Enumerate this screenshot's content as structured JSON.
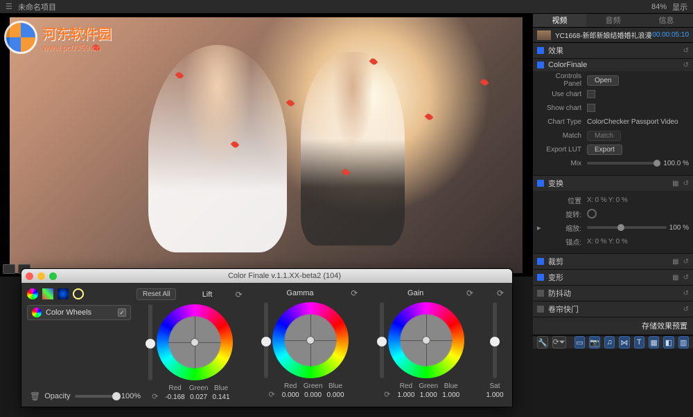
{
  "topbar": {
    "project": "未命名项目",
    "zoom": "84%",
    "display_btn": "显示"
  },
  "watermark": {
    "line1": "河东软件园",
    "line2": "www.pc0359.cn"
  },
  "inspector": {
    "tabs": {
      "video": "视频",
      "audio": "音频",
      "info": "信息"
    },
    "clip": {
      "name": "YC1668-新郎新娘结婚婚礼浪漫",
      "timecode": "00:00:05:10"
    },
    "effects": {
      "title": "效果"
    },
    "colorfinale": {
      "title": "ColorFinale",
      "controls_panel": "Controls Panel",
      "open": "Open",
      "use_chart": "Use chart",
      "show_chart": "Show chart",
      "chart_type": "Chart Type",
      "chart_type_val": "ColorChecker Passport Video",
      "match": "Match",
      "match_btn": "Match",
      "export_lut": "Export LUT",
      "export_btn": "Export",
      "mix": "Mix",
      "mix_val": "100.0 %"
    },
    "transform": {
      "title": "变换",
      "position": "位置",
      "pos_x": "X:",
      "pos_x_val": "0 %",
      "pos_y": "Y:",
      "pos_y_val": "0 %",
      "rotation": "旋转:",
      "rotation_val": "",
      "scale": "缩放:",
      "scale_val": "100 %",
      "anchor": "锚点:",
      "an_x": "X:",
      "an_x_val": "0 %",
      "an_y": "Y:",
      "an_y_val": "0 %"
    },
    "crop": {
      "title": "裁剪"
    },
    "distort": {
      "title": "变形"
    },
    "stabilize": {
      "title": "防抖动"
    },
    "rolling": {
      "title": "卷帘快门"
    },
    "save_preset": "存储效果预置"
  },
  "cf": {
    "title": "Color Finale v.1.1.XX-beta2 (104)",
    "layer_name": "Color Wheels",
    "opacity_label": "Opacity",
    "opacity_val": "100%",
    "reset_all": "Reset All",
    "lift": {
      "label": "Lift",
      "red_l": "Red",
      "green_l": "Green",
      "blue_l": "Blue",
      "red": "-0.168",
      "green": "0.027",
      "blue": "0.141"
    },
    "gamma": {
      "label": "Gamma",
      "red_l": "Red",
      "green_l": "Green",
      "blue_l": "Blue",
      "red": "0.000",
      "green": "0.000",
      "blue": "0.000"
    },
    "gain": {
      "label": "Gain",
      "red_l": "Red",
      "green_l": "Green",
      "blue_l": "Blue",
      "red": "1.000",
      "green": "1.000",
      "blue": "1.000"
    },
    "sat": {
      "label": "Sat",
      "val": "1.000"
    }
  }
}
